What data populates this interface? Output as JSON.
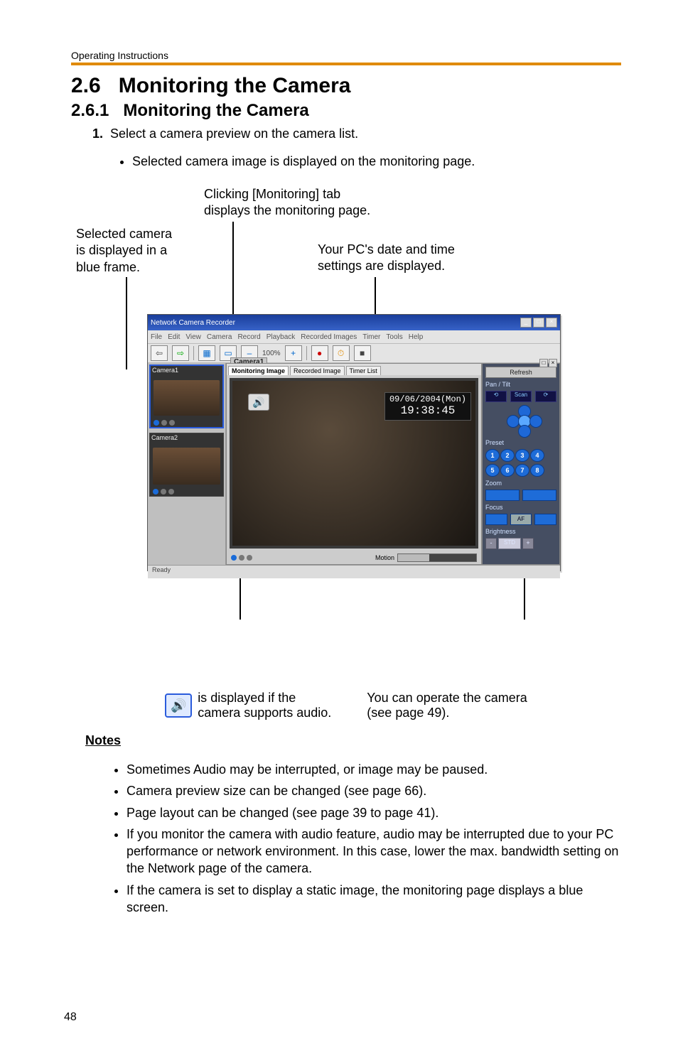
{
  "running_head": "Operating Instructions",
  "section_number": "2.6",
  "section_title": "Monitoring the Camera",
  "sub_number": "2.6.1",
  "sub_title": "Monitoring the Camera",
  "step_num": "1.",
  "step_text": "Select a camera preview on the camera list.",
  "step_sub": "Selected camera image is displayed on the monitoring page.",
  "callouts": {
    "top_center_l1": "Clicking [Monitoring] tab",
    "top_center_l2": "displays the monitoring page.",
    "top_left_l1": "Selected camera",
    "top_left_l2": "is displayed in a",
    "top_left_l3": "blue frame.",
    "top_right_l1": "Your PC's date and time",
    "top_right_l2": "settings are displayed.",
    "bottom_audio_line1": " is displayed if the",
    "bottom_audio_line2": "camera supports audio.",
    "bottom_operate_l1": "You can operate the camera",
    "bottom_operate_l2": "(see page 49)."
  },
  "app": {
    "title": "Network Camera Recorder",
    "menus": [
      "File",
      "Edit",
      "View",
      "Camera",
      "Record",
      "Playback",
      "Recorded Images",
      "Timer",
      "Tools",
      "Help"
    ],
    "toolbar_zoom": "100%",
    "pane_title": "Camera1",
    "tabs": [
      "Monitoring Image",
      "Recorded Image",
      "Timer List"
    ],
    "timestamp_date": "09/06/2004(Mon)",
    "timestamp_time": "19:38:45",
    "motion_label": "Motion",
    "status": "Ready",
    "cam1_label": "Camera1",
    "cam2_label": "Camera2",
    "right": {
      "refresh": "Refresh",
      "pantilt": "Pan / Tilt",
      "scan": "Scan",
      "preset": "Preset",
      "presets": [
        "1",
        "2",
        "3",
        "4",
        "5",
        "6",
        "7",
        "8"
      ],
      "zoom": "Zoom",
      "focus": "Focus",
      "af": "AF",
      "brightness": "Brightness",
      "std": "STD"
    }
  },
  "notes_head": "Notes",
  "notes": [
    "Sometimes Audio may be interrupted, or image may be paused.",
    "Camera preview size can be changed (see page 66).",
    "Page layout can be changed (see page 39 to page 41).",
    "If you monitor the camera with audio feature, audio may be interrupted due to your PC performance or network environment. In this case, lower the max. bandwidth setting on the Network page of the camera.",
    "If the camera is set to display a static image, the monitoring page displays a blue screen."
  ],
  "page_number": "48"
}
